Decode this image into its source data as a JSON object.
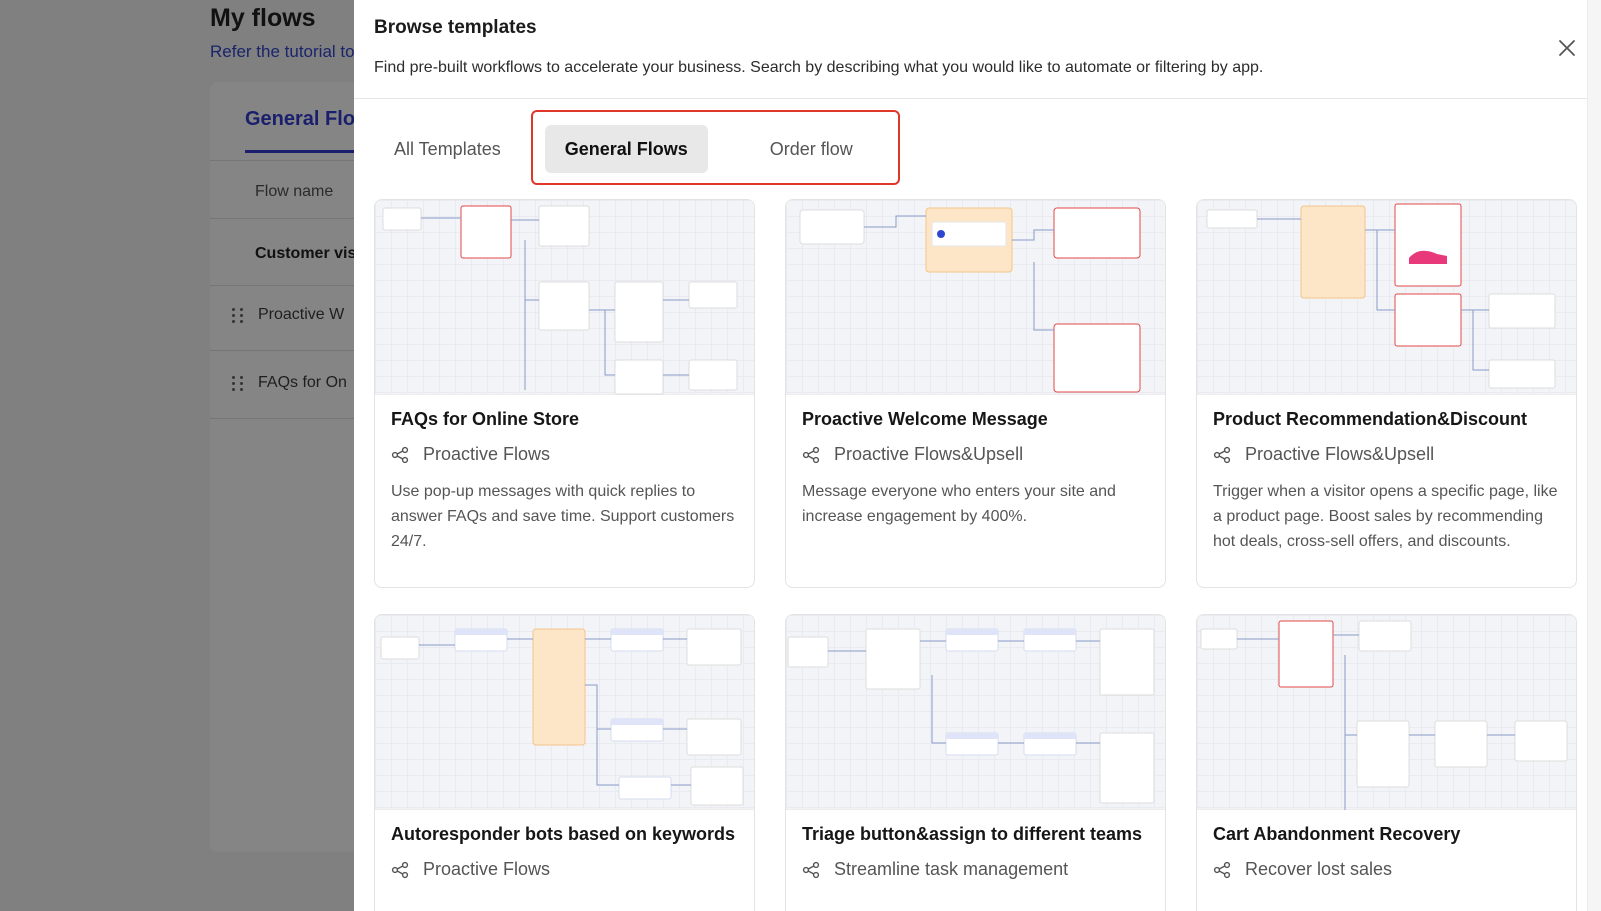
{
  "background": {
    "title": "My flows",
    "tutorial_text": "Refer the tutorial to",
    "tab_label": "General Flo",
    "column_label": "Flow name",
    "group_label": "Customer vis",
    "rows": [
      "Proactive W",
      "FAQs for On"
    ]
  },
  "modal": {
    "title": "Browse templates",
    "description": "Find pre-built workflows to accelerate your business. Search by describing what you would like to automate or filtering by app.",
    "tabs": [
      "All Templates",
      "General Flows",
      "Order flow"
    ],
    "active_tab": "General Flows",
    "highlight_color": "#e0372b"
  },
  "templates": [
    {
      "title": "FAQs for Online Store",
      "category": "Proactive Flows",
      "description": "Use pop-up messages with quick replies to answer FAQs and save time. Support customers 24/7."
    },
    {
      "title": "Proactive Welcome Message",
      "category": "Proactive Flows&Upsell",
      "description": "Message everyone who enters your site and increase engagement by 400%."
    },
    {
      "title": "Product Recommendation&Discount",
      "category": "Proactive Flows&Upsell",
      "description": "Trigger when a visitor opens a specific page, like a product page. Boost sales by recommending hot deals, cross-sell offers, and discounts."
    },
    {
      "title": "Autoresponder bots based on keywords",
      "category": "Proactive Flows",
      "description": ""
    },
    {
      "title": "Triage button&assign to different teams",
      "category": "Streamline task management",
      "description": ""
    },
    {
      "title": "Cart Abandonment Recovery",
      "category": "Recover lost sales",
      "description": ""
    }
  ],
  "icons": {
    "close": "close-icon",
    "category": "flow-share-icon",
    "drag": "drag-handle-icon"
  }
}
